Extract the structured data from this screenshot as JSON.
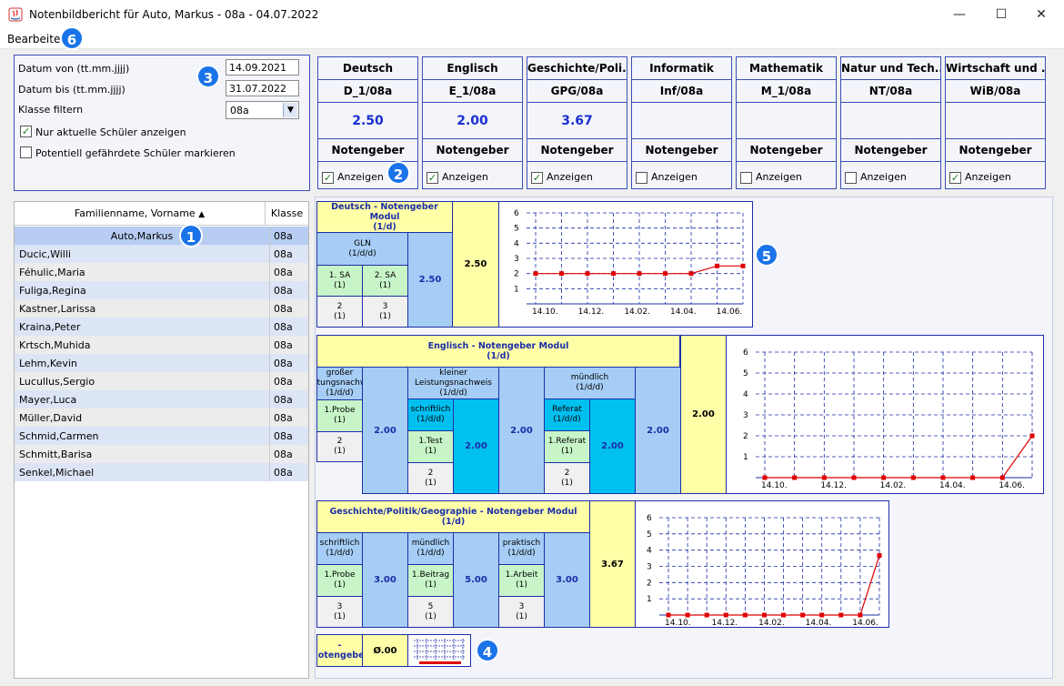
{
  "window": {
    "title": "Notenbildbericht für Auto, Markus - 08a - 04.07.2022",
    "minimize": "—",
    "maximize": "☐",
    "close": "✕"
  },
  "menu": {
    "bearbeiten": "Bearbeiten"
  },
  "badges": {
    "b1": "1",
    "b2": "2",
    "b3": "3",
    "b4": "4",
    "b5": "5",
    "b6": "6"
  },
  "filter": {
    "datum_von_label": "Datum von (tt.mm.jjjj)",
    "datum_von": "14.09.2021",
    "datum_bis_label": "Datum bis (tt.mm.jjjj)",
    "datum_bis": "31.07.2022",
    "klasse_label": "Klasse filtern",
    "klasse": "08a",
    "nur_aktuelle": "Nur aktuelle Schüler anzeigen",
    "gefaehrdet": "Potentiell gefährdete Schüler markieren"
  },
  "subjects": [
    {
      "name": "Deutsch",
      "code": "D_1/08a",
      "grade": "2.50",
      "notengeber": "Notengeber",
      "show": "Anzeigen",
      "checked": true
    },
    {
      "name": "Englisch",
      "code": "E_1/08a",
      "grade": "2.00",
      "notengeber": "Notengeber",
      "show": "Anzeigen",
      "checked": true
    },
    {
      "name": "Geschichte/Poli...",
      "code": "GPG/08a",
      "grade": "3.67",
      "notengeber": "Notengeber",
      "show": "Anzeigen",
      "checked": true
    },
    {
      "name": "Informatik",
      "code": "Inf/08a",
      "grade": "",
      "notengeber": "Notengeber",
      "show": "Anzeigen",
      "checked": false
    },
    {
      "name": "Mathematik",
      "code": "M_1/08a",
      "grade": "",
      "notengeber": "Notengeber",
      "show": "Anzeigen",
      "checked": false
    },
    {
      "name": "Natur und Tech...",
      "code": "NT/08a",
      "grade": "",
      "notengeber": "Notengeber",
      "show": "Anzeigen",
      "checked": false
    },
    {
      "name": "Wirtschaft und ...",
      "code": "WiB/08a",
      "grade": "",
      "notengeber": "Notengeber",
      "show": "Anzeigen",
      "checked": true
    }
  ],
  "students": {
    "header_name": "Familienname, Vorname",
    "sort_arrow": "▲",
    "header_klasse": "Klasse",
    "rows": [
      {
        "name": "Auto,Markus",
        "klasse": "08a"
      },
      {
        "name": "Ducic,Willi",
        "klasse": "08a"
      },
      {
        "name": "Féhulic,Maria",
        "klasse": "08a"
      },
      {
        "name": "Fuliga,Regina",
        "klasse": "08a"
      },
      {
        "name": "Kastner,Larissa",
        "klasse": "08a"
      },
      {
        "name": "Kraina,Peter",
        "klasse": "08a"
      },
      {
        "name": "Krtsch,Muhida",
        "klasse": "08a"
      },
      {
        "name": "Lehm,Kevin",
        "klasse": "08a"
      },
      {
        "name": "Lucullus,Sergio",
        "klasse": "08a"
      },
      {
        "name": "Mayer,Luca",
        "klasse": "08a"
      },
      {
        "name": "Müller,David",
        "klasse": "08a"
      },
      {
        "name": "Schmid,Carmen",
        "klasse": "08a"
      },
      {
        "name": "Schmitt,Barisa",
        "klasse": "08a"
      },
      {
        "name": "Senkel,Michael",
        "klasse": "08a"
      }
    ]
  },
  "deutsch": {
    "title1": "Deutsch - Notengeber Modul",
    "title2": "(1/d)",
    "gln1": "GLN",
    "gln2": "(1/d/d)",
    "sa1": "1. SA",
    "sa1w": "(1)",
    "sa2": "2. SA",
    "sa2w": "(1)",
    "n1": "2",
    "n1w": "(1)",
    "n2": "3",
    "n2w": "(1)",
    "gln_val": "2.50",
    "total": "2.50"
  },
  "englisch": {
    "title1": "Englisch - Notengeber Modul",
    "title2": "(1/d)",
    "gl1": "großer",
    "gl2": "Leistungsnachweis",
    "gl3": "(1/d/d)",
    "gl_item": "1.Probe",
    "gl_itemw": "(1)",
    "gl_n": "2",
    "gl_nw": "(1)",
    "gl_val": "2.00",
    "kl1": "kleiner",
    "kl2": "Leistungsnachweis",
    "kl3": "(1/d/d)",
    "sch1": "schriftlich",
    "sch2": "(1/d/d)",
    "test": "1.Test",
    "testw": "(1)",
    "test_n": "2",
    "test_nw": "(1)",
    "sch_val": "2.00",
    "kl_val": "2.00",
    "mu1": "mündlich",
    "mu2": "(1/d/d)",
    "ref1": "Referat",
    "ref2": "(1/d/d)",
    "refi": "1.Referat",
    "refiw": "(1)",
    "ref_n": "2",
    "ref_nw": "(1)",
    "ref_val": "2.00",
    "mu_val": "2.00",
    "total": "2.00"
  },
  "gpg": {
    "title1": "Geschichte/Politik/Geographie - Notengeber Modul",
    "title2": "(1/d)",
    "s1": "schriftlich",
    "s2": "(1/d/d)",
    "si": "1.Probe",
    "siw": "(1)",
    "sn": "3",
    "snw": "(1)",
    "sval": "3.00",
    "m1": "mündlich",
    "m2": "(1/d/d)",
    "mi": "1.Beitrag",
    "miw": "(1)",
    "mn": "5",
    "mnw": "(1)",
    "mval": "5.00",
    "p1": "praktisch",
    "p2": "(1/d/d)",
    "pi": "1.Arbeit",
    "piw": "(1)",
    "pn": "3",
    "pnw": "(1)",
    "pval": "3.00",
    "total": "3.67"
  },
  "extra": {
    "label1": "-",
    "label2": "Notengeber",
    "val": "Ø.00"
  },
  "chart_data": [
    {
      "type": "line",
      "title": "",
      "xticks": [
        "14.10.",
        "14.12.",
        "14.02.",
        "14.04.",
        "14.06."
      ],
      "yticks": [
        "1",
        "2",
        "3",
        "4",
        "5",
        "6"
      ],
      "ylim": [
        0,
        6
      ],
      "grid": true,
      "series": [
        {
          "color": "#e00000",
          "x": [
            0,
            1,
            2,
            3,
            4,
            5,
            6,
            7,
            8
          ],
          "values": [
            2,
            2,
            2,
            2,
            2,
            2,
            2,
            2.5,
            2.5
          ]
        }
      ]
    },
    {
      "type": "line",
      "title": "",
      "xticks": [
        "14.10.",
        "14.12.",
        "14.02.",
        "14.04.",
        "14.06."
      ],
      "yticks": [
        "1",
        "2",
        "3",
        "4",
        "5",
        "6"
      ],
      "ylim": [
        0,
        6
      ],
      "grid": true,
      "series": [
        {
          "color": "#e00000",
          "x": [
            0,
            1,
            2,
            3,
            4,
            5,
            6,
            7,
            8,
            9
          ],
          "values": [
            0,
            0,
            0,
            0,
            0,
            0,
            0,
            0,
            0,
            2
          ]
        }
      ]
    },
    {
      "type": "line",
      "title": "",
      "xticks": [
        "14.10.",
        "14.12.",
        "14.02.",
        "14.04.",
        "14.06."
      ],
      "yticks": [
        "1",
        "2",
        "3",
        "4",
        "5",
        "6"
      ],
      "ylim": [
        0,
        6
      ],
      "grid": true,
      "series": [
        {
          "color": "#e00000",
          "x": [
            0,
            1,
            2,
            3,
            4,
            5,
            6,
            7,
            8,
            9,
            10,
            11
          ],
          "values": [
            0,
            0,
            0,
            0,
            0,
            0,
            0,
            0,
            0,
            0,
            0,
            3.67
          ]
        }
      ]
    }
  ]
}
